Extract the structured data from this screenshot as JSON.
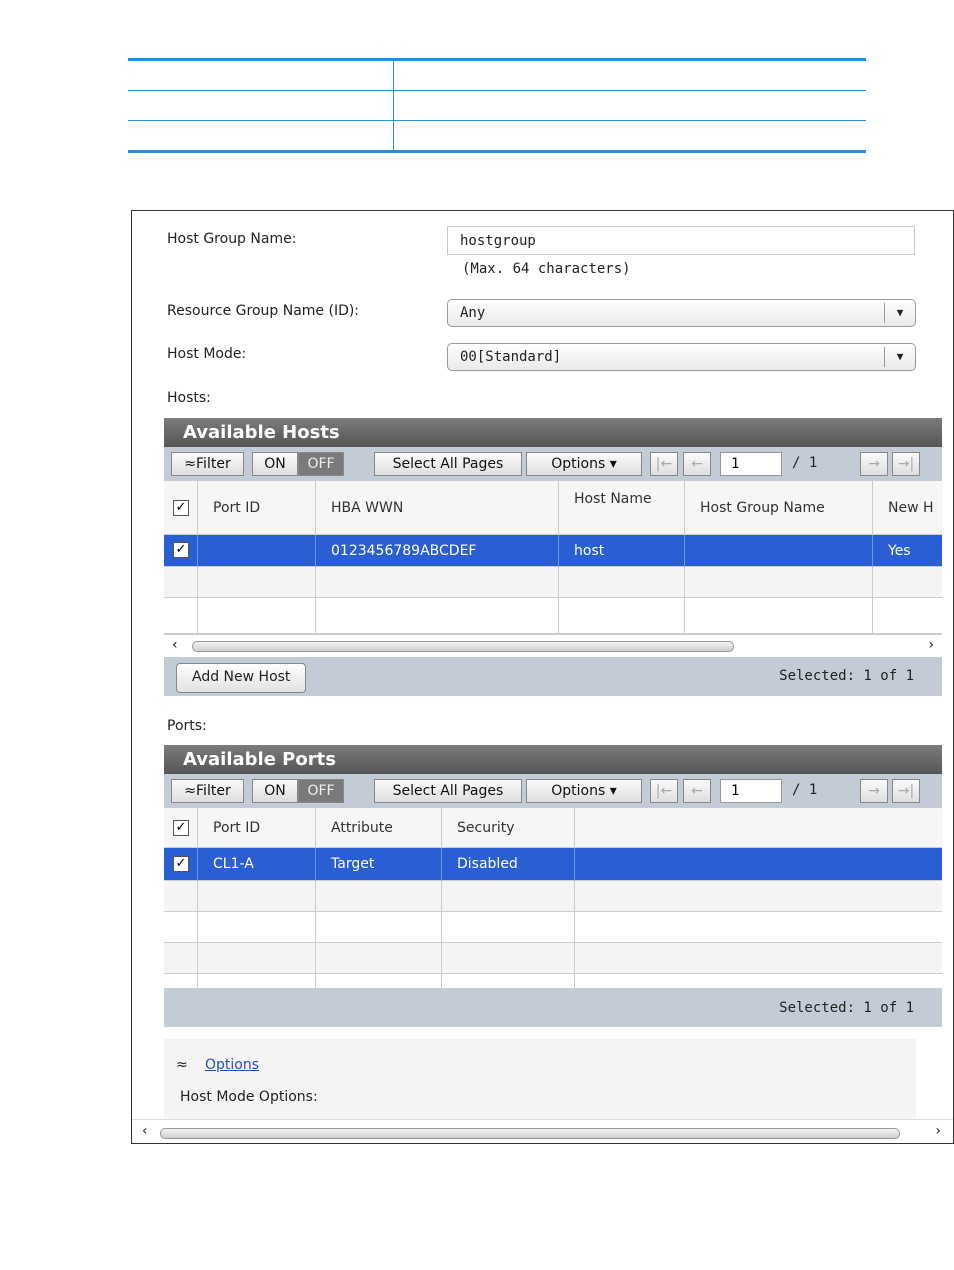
{
  "form": {
    "host_group_name_label": "Host Group Name:",
    "host_group_name_value": "hostgroup",
    "host_group_name_hint": "(Max. 64 characters)",
    "resource_group_label": "Resource Group Name (ID):",
    "resource_group_value": "Any",
    "host_mode_label": "Host Mode:",
    "host_mode_value": "00[Standard]",
    "hosts_label": "Hosts:",
    "ports_label": "Ports:"
  },
  "toolbar": {
    "filter": "≈Filter",
    "on": "ON",
    "off": "OFF",
    "select_all_pages": "Select All Pages",
    "options": "Options ▾",
    "page_value": "1",
    "page_total": "/ 1"
  },
  "hosts_panel": {
    "title": "Available Hosts",
    "columns": [
      "Port ID",
      "HBA WWN",
      "Host Name",
      "Host Group Name",
      "New H"
    ],
    "rows": [
      {
        "port_id": "",
        "hba_wwn": "0123456789ABCDEF",
        "host_name": "host",
        "host_group_name": "",
        "new_host": "Yes"
      }
    ],
    "add_button": "Add New Host",
    "selected_text": "Selected:  1   of  1"
  },
  "ports_panel": {
    "title": "Available Ports",
    "columns": [
      "Port ID",
      "Attribute",
      "Security"
    ],
    "rows": [
      {
        "port_id": "CL1-A",
        "attribute": "Target",
        "security": "Disabled"
      }
    ],
    "selected_text": "Selected:  1   of  1"
  },
  "options_section": {
    "link": "Options",
    "host_mode_options_label": "Host Mode Options:"
  }
}
